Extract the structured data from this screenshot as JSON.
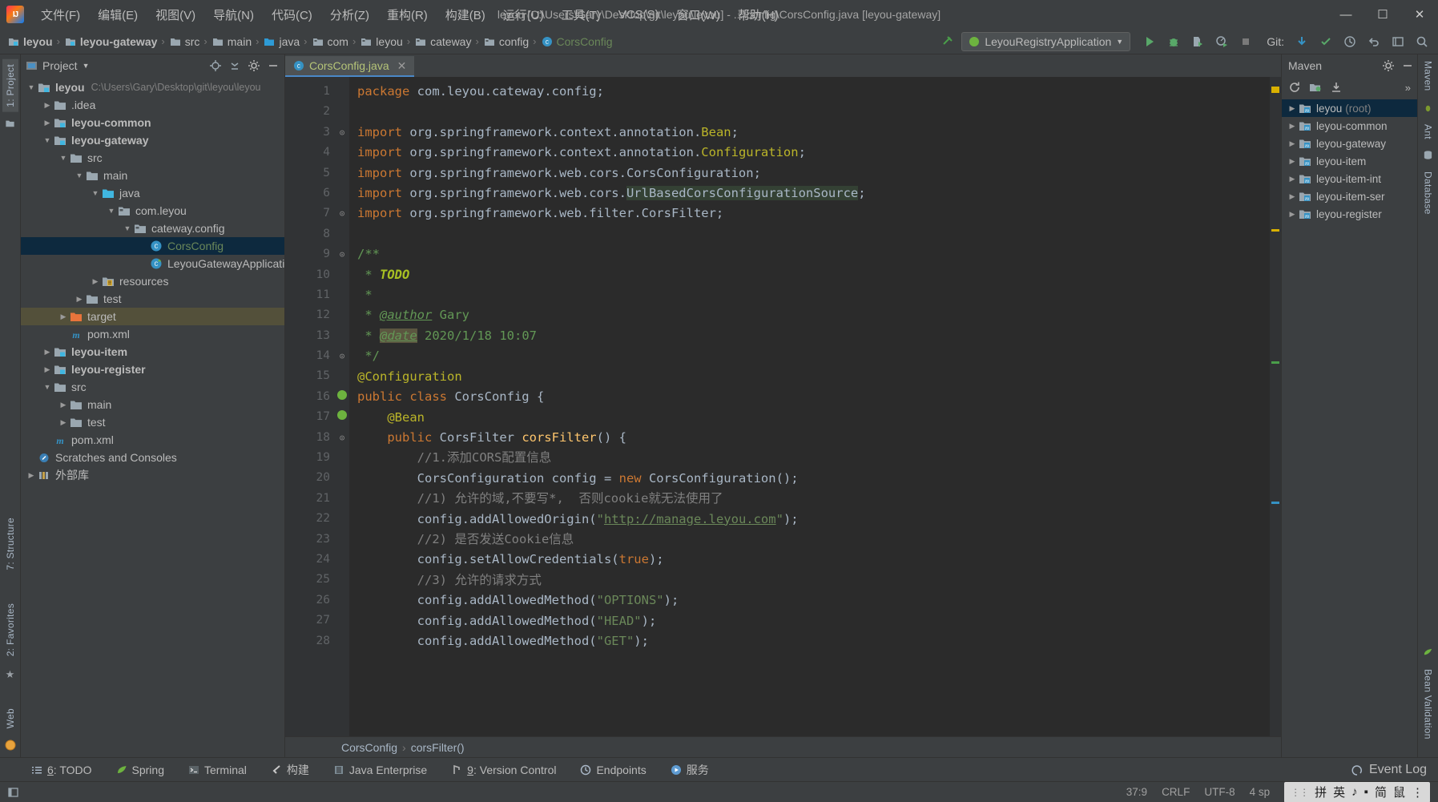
{
  "window": {
    "title": "leyou [C:\\Users\\Gary\\Desktop\\git\\leyou\\leyou] - ...\\config\\CorsConfig.java [leyou-gateway]",
    "minimize": "—",
    "maximize": "☐",
    "close": "✕"
  },
  "menubar": [
    {
      "label": "文件(F)"
    },
    {
      "label": "编辑(E)"
    },
    {
      "label": "视图(V)"
    },
    {
      "label": "导航(N)"
    },
    {
      "label": "代码(C)"
    },
    {
      "label": "分析(Z)"
    },
    {
      "label": "重构(R)"
    },
    {
      "label": "构建(B)"
    },
    {
      "label": "运行(U)"
    },
    {
      "label": "工具(T)"
    },
    {
      "label": "VCS(S)"
    },
    {
      "label": "窗口(W)"
    },
    {
      "label": "帮助(H)"
    }
  ],
  "navbar": {
    "crumbs": [
      {
        "label": "leyou",
        "icon": "module-icon"
      },
      {
        "label": "leyou-gateway",
        "icon": "module-icon"
      },
      {
        "label": "src",
        "icon": "folder-icon"
      },
      {
        "label": "main",
        "icon": "folder-icon"
      },
      {
        "label": "java",
        "icon": "source-folder-icon"
      },
      {
        "label": "com",
        "icon": "package-icon"
      },
      {
        "label": "leyou",
        "icon": "package-icon"
      },
      {
        "label": "cateway",
        "icon": "package-icon"
      },
      {
        "label": "config",
        "icon": "package-icon"
      },
      {
        "label": "CorsConfig",
        "icon": "class-icon"
      }
    ],
    "separator": "›",
    "run_configuration": "LeyouRegistryApplication",
    "run_config_caret": "▼",
    "git_label": "Git:",
    "buttons": [
      {
        "name": "run-button"
      },
      {
        "name": "debug-button"
      },
      {
        "name": "run-with-coverage-button"
      },
      {
        "name": "profile-button"
      },
      {
        "name": "stop-button"
      },
      {
        "name": "git-update-button"
      },
      {
        "name": "git-commit-button"
      },
      {
        "name": "git-history-button"
      },
      {
        "name": "undo-button"
      },
      {
        "name": "settings-button"
      },
      {
        "name": "search-button"
      }
    ]
  },
  "left_strip": {
    "tabs": [
      {
        "label": "1: Project",
        "selected": true
      },
      {
        "label": "7: Structure",
        "selected": false
      },
      {
        "label": "2: Favorites",
        "selected": false
      },
      {
        "label": "Web",
        "selected": false
      }
    ]
  },
  "project_panel": {
    "title": "Project",
    "caret": "▼",
    "actions": [
      "locate-icon",
      "collapse-all-icon",
      "gear-icon",
      "hide-icon"
    ],
    "tree": [
      {
        "depth": 0,
        "arrow": "▼",
        "icon": "module-icon",
        "label": "leyou",
        "bold": true,
        "path": "C:\\Users\\Gary\\Desktop\\git\\leyou\\leyou"
      },
      {
        "depth": 1,
        "arrow": "▶",
        "icon": "folder-icon",
        "label": ".idea",
        "bold": false,
        "path": ""
      },
      {
        "depth": 1,
        "arrow": "▶",
        "icon": "module-icon",
        "label": "leyou-common",
        "bold": true,
        "path": ""
      },
      {
        "depth": 1,
        "arrow": "▼",
        "icon": "module-icon",
        "label": "leyou-gateway",
        "bold": true,
        "path": ""
      },
      {
        "depth": 2,
        "arrow": "▼",
        "icon": "folder-icon",
        "label": "src",
        "bold": false,
        "path": ""
      },
      {
        "depth": 3,
        "arrow": "▼",
        "icon": "folder-icon",
        "label": "main",
        "bold": false,
        "path": ""
      },
      {
        "depth": 4,
        "arrow": "▼",
        "icon": "source-folder-icon",
        "label": "java",
        "bold": false,
        "path": ""
      },
      {
        "depth": 5,
        "arrow": "▼",
        "icon": "package-icon",
        "label": "com.leyou",
        "bold": false,
        "path": ""
      },
      {
        "depth": 6,
        "arrow": "▼",
        "icon": "package-icon",
        "label": "cateway.config",
        "bold": false,
        "path": ""
      },
      {
        "depth": 7,
        "arrow": "",
        "icon": "class-icon",
        "label": "CorsConfig",
        "bold": false,
        "path": "",
        "selected": true
      },
      {
        "depth": 7,
        "arrow": "",
        "icon": "spring-class-icon",
        "label": "LeyouGatewayApplication",
        "bold": false,
        "path": ""
      },
      {
        "depth": 4,
        "arrow": "▶",
        "icon": "resources-icon",
        "label": "resources",
        "bold": false,
        "path": ""
      },
      {
        "depth": 3,
        "arrow": "▶",
        "icon": "folder-icon",
        "label": "test",
        "bold": false,
        "path": ""
      },
      {
        "depth": 2,
        "arrow": "▶",
        "icon": "target-folder-icon",
        "label": "target",
        "bold": false,
        "path": "",
        "highlight": true
      },
      {
        "depth": 2,
        "arrow": "",
        "icon": "maven-file-icon",
        "label": "pom.xml",
        "bold": false,
        "path": ""
      },
      {
        "depth": 1,
        "arrow": "▶",
        "icon": "module-icon",
        "label": "leyou-item",
        "bold": true,
        "path": ""
      },
      {
        "depth": 1,
        "arrow": "▶",
        "icon": "module-icon",
        "label": "leyou-register",
        "bold": true,
        "path": ""
      },
      {
        "depth": 1,
        "arrow": "▼",
        "icon": "folder-icon",
        "label": "src",
        "bold": false,
        "path": ""
      },
      {
        "depth": 2,
        "arrow": "▶",
        "icon": "folder-icon",
        "label": "main",
        "bold": false,
        "path": ""
      },
      {
        "depth": 2,
        "arrow": "▶",
        "icon": "folder-icon",
        "label": "test",
        "bold": false,
        "path": ""
      },
      {
        "depth": 1,
        "arrow": "",
        "icon": "maven-file-icon",
        "label": "pom.xml",
        "bold": false,
        "path": ""
      },
      {
        "depth": 0,
        "arrow": "",
        "icon": "scratch-icon",
        "label": "Scratches and Consoles",
        "bold": false,
        "path": ""
      },
      {
        "depth": 0,
        "arrow": "▶",
        "icon": "library-icon",
        "label": "外部库",
        "bold": false,
        "path": ""
      }
    ]
  },
  "editor": {
    "tab": {
      "label": "CorsConfig.java",
      "close": "✕",
      "icon": "java-class-icon"
    },
    "line_count": 28,
    "first_line": 1,
    "lines": [
      {
        "n": 1,
        "fold": "",
        "html": "<span class='kw'>package</span> com.leyou.cateway.config;"
      },
      {
        "n": 2,
        "fold": "",
        "html": ""
      },
      {
        "n": 3,
        "fold": "⊙",
        "html": "<span class='kw'>import</span> org.springframework.context.annotation.<span class='ann'>Bean</span>;"
      },
      {
        "n": 4,
        "fold": "",
        "html": "<span class='kw'>import</span> org.springframework.context.annotation.<span class='ann'>Configuration</span>;"
      },
      {
        "n": 5,
        "fold": "",
        "html": "<span class='kw'>import</span> org.springframework.web.cors.CorsConfiguration;"
      },
      {
        "n": 6,
        "fold": "",
        "html": "<span class='kw'>import</span> org.springframework.web.cors.<span class='hl-ident'>UrlBasedCorsConfigurationSource</span>;"
      },
      {
        "n": 7,
        "fold": "⊙",
        "html": "<span class='kw'>import</span> org.springframework.web.filter.CorsFilter;"
      },
      {
        "n": 8,
        "fold": "",
        "html": ""
      },
      {
        "n": 9,
        "fold": "⊙",
        "html": "<span class='doc'>/**</span>"
      },
      {
        "n": 10,
        "fold": "",
        "html": "<span class='doc'> * </span><span class='todo'>TODO</span>"
      },
      {
        "n": 11,
        "fold": "",
        "html": "<span class='doc'> *</span>"
      },
      {
        "n": 12,
        "fold": "",
        "html": "<span class='doc'> * </span><span class='doctag'>@author</span><span class='doc'> Gary</span>"
      },
      {
        "n": 13,
        "fold": "",
        "html": "<span class='doc'> * </span><span class='doctag hl-date'>@date</span><span class='doc'> 2020/1/18 10:07</span>"
      },
      {
        "n": 14,
        "fold": "⊙",
        "html": "<span class='doc'> */</span>"
      },
      {
        "n": 15,
        "fold": "",
        "html": "<span class='ann'>@Configuration</span>"
      },
      {
        "n": 16,
        "fold": "",
        "html": "<span class='kw'>public class</span> CorsConfig {"
      },
      {
        "n": 17,
        "fold": "",
        "html": "    <span class='ann'>@Bean</span>"
      },
      {
        "n": 18,
        "fold": "⊙",
        "html": "    <span class='kw'>public</span> CorsFilter <span style='color:#ffc66d'>corsFilter</span>() {"
      },
      {
        "n": 19,
        "fold": "",
        "html": "        <span class='cm'>//1.添加CORS配置信息</span>"
      },
      {
        "n": 20,
        "fold": "",
        "html": "        CorsConfiguration config = <span class='kw'>new</span> CorsConfiguration();"
      },
      {
        "n": 21,
        "fold": "",
        "html": "        <span class='cm'>//1) 允许的域,不要写*,  否则cookie就无法使用了</span>"
      },
      {
        "n": 22,
        "fold": "",
        "html": "        config.addAllowedOrigin(<span class='str'>\"</span><span class='url'>http://manage.leyou.com</span><span class='str'>\"</span>);"
      },
      {
        "n": 23,
        "fold": "",
        "html": "        <span class='cm'>//2) 是否发送Cookie信息</span>"
      },
      {
        "n": 24,
        "fold": "",
        "html": "        config.setAllowCredentials(<span class='kw'>true</span>);"
      },
      {
        "n": 25,
        "fold": "",
        "html": "        <span class='cm'>//3) 允许的请求方式</span>"
      },
      {
        "n": 26,
        "fold": "",
        "html": "        config.addAllowedMethod(<span class='str'>\"OPTIONS\"</span>);"
      },
      {
        "n": 27,
        "fold": "",
        "html": "        config.addAllowedMethod(<span class='str'>\"HEAD\"</span>);"
      },
      {
        "n": 28,
        "fold": "",
        "html": "        config.addAllowedMethod(<span class='str'>\"GET\"</span>);"
      }
    ],
    "gutter_marks": [
      {
        "line": 16,
        "name": "spring-bean-gutter-icon"
      },
      {
        "line": 17,
        "name": "bean-definition-gutter-icon"
      }
    ],
    "breadcrumbs": [
      "CorsConfig",
      "corsFilter()"
    ],
    "breadcrumb_separator": "›"
  },
  "maven_panel": {
    "title": "Maven",
    "actions": [
      "gear-icon",
      "hide-icon"
    ],
    "toolbar": [
      "reload-icon",
      "add-maven-project-icon",
      "download-sources-icon",
      "more-icon"
    ],
    "more": "»",
    "tree": [
      {
        "label": "leyou",
        "suffix": "(root)",
        "arrow": "▶",
        "selected": true
      },
      {
        "label": "leyou-common",
        "suffix": "",
        "arrow": "▶",
        "selected": false
      },
      {
        "label": "leyou-gateway",
        "suffix": "",
        "arrow": "▶",
        "selected": false
      },
      {
        "label": "leyou-item",
        "suffix": "",
        "arrow": "▶",
        "selected": false
      },
      {
        "label": "leyou-item-int",
        "suffix": "",
        "arrow": "▶",
        "selected": false
      },
      {
        "label": "leyou-item-ser",
        "suffix": "",
        "arrow": "▶",
        "selected": false
      },
      {
        "label": "leyou-register",
        "suffix": "",
        "arrow": "▶",
        "selected": false
      }
    ]
  },
  "right_strip": {
    "tabs": [
      {
        "label": "Maven"
      },
      {
        "label": "Ant"
      },
      {
        "label": "Database"
      },
      {
        "label": "Bean Validation"
      }
    ]
  },
  "bottom_toolwindows": [
    {
      "num": "6",
      "label": ": TODO",
      "icon": "todo-icon"
    },
    {
      "num": "",
      "label": "Spring",
      "icon": "spring-icon"
    },
    {
      "num": "",
      "label": "Terminal",
      "icon": "terminal-icon"
    },
    {
      "num": "",
      "label": "构建",
      "icon": "build-icon"
    },
    {
      "num": "",
      "label": "Java Enterprise",
      "icon": "java-enterprise-icon"
    },
    {
      "num": "9",
      "label": ": Version Control",
      "icon": "version-control-icon"
    },
    {
      "num": "",
      "label": "Endpoints",
      "icon": "endpoints-icon"
    },
    {
      "num": "",
      "label": "服务",
      "icon": "services-icon"
    }
  ],
  "event_log": {
    "label": "Event Log",
    "icon": "event-log-icon"
  },
  "statusbar": {
    "caret": "37:9",
    "line_separator": "CRLF",
    "encoding": "UTF-8",
    "indent": "4 sp",
    "ime": {
      "items": [
        "拼",
        "英",
        "♪",
        "▪",
        "简",
        "鼠",
        "⋮"
      ]
    }
  }
}
